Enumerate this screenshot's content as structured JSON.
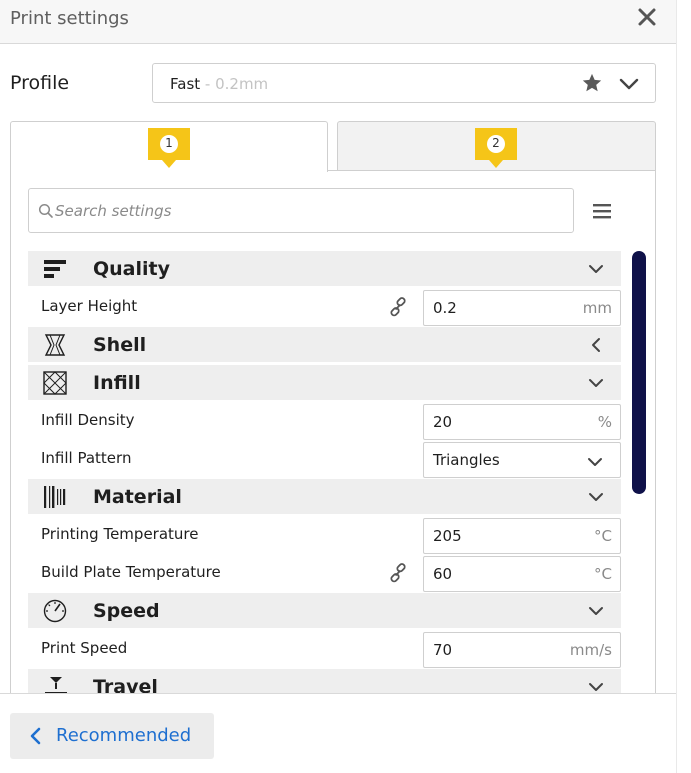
{
  "header": {
    "title": "Print settings"
  },
  "profile": {
    "label": "Profile",
    "name": "Fast",
    "sub": " - 0.2mm"
  },
  "tabs": [
    {
      "badge": "1"
    },
    {
      "badge": "2"
    }
  ],
  "search": {
    "placeholder": "Search settings"
  },
  "colors": {
    "accent": "#1e6fd0",
    "badge": "#f5c518",
    "scrollbar": "#0f1149",
    "category_bg": "#eeeeee"
  },
  "categories": {
    "quality": {
      "label": "Quality",
      "icon": "quality-icon"
    },
    "shell": {
      "label": "Shell",
      "icon": "shell-icon"
    },
    "infill": {
      "label": "Infill",
      "icon": "infill-icon"
    },
    "material": {
      "label": "Material",
      "icon": "material-icon"
    },
    "speed": {
      "label": "Speed",
      "icon": "speed-icon"
    },
    "travel": {
      "label": "Travel",
      "icon": "travel-icon"
    }
  },
  "settings": {
    "layer_height": {
      "label": "Layer Height",
      "value": "0.2",
      "unit": "mm"
    },
    "infill_density": {
      "label": "Infill Density",
      "value": "20",
      "unit": "%"
    },
    "infill_pattern": {
      "label": "Infill Pattern",
      "value": "Triangles"
    },
    "printing_temperature": {
      "label": "Printing Temperature",
      "value": "205",
      "unit": "°C"
    },
    "build_plate_temperature": {
      "label": "Build Plate Temperature",
      "value": "60",
      "unit": "°C"
    },
    "print_speed": {
      "label": "Print Speed",
      "value": "70",
      "unit": "mm/s"
    }
  },
  "footer": {
    "button_label": "Recommended"
  }
}
